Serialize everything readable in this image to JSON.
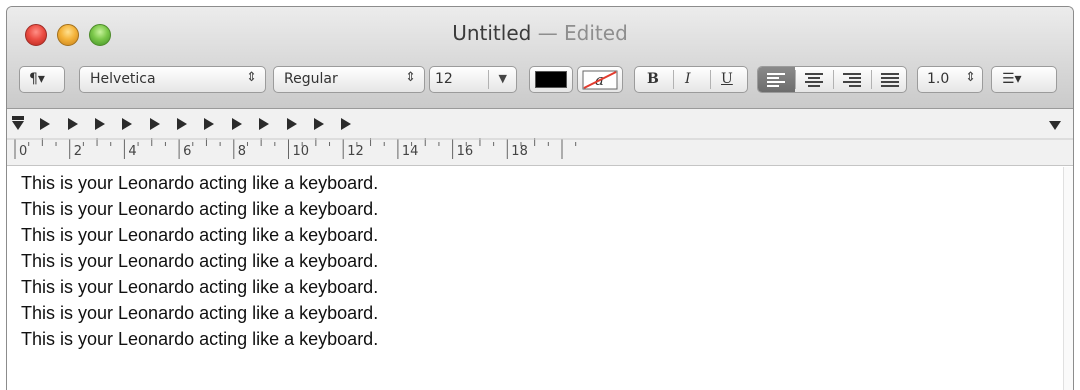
{
  "window": {
    "title": "Untitled",
    "separator": "—",
    "status": "Edited"
  },
  "toolbar": {
    "paragraph_styles": "¶▾",
    "font_family": "Helvetica",
    "font_style": "Regular",
    "font_size": "12",
    "text_color": "#000000",
    "bold": "B",
    "italic": "I",
    "underline": "U",
    "alignment": [
      "align-left",
      "align-center",
      "align-right",
      "align-justify"
    ],
    "selected_alignment": "align-left",
    "line_spacing": "1.0",
    "list_bullets": "☰▾"
  },
  "ruler": {
    "numbers": [
      "0",
      "2",
      "4",
      "6",
      "8",
      "10",
      "12",
      "14",
      "16",
      "18"
    ]
  },
  "document": {
    "lines": [
      "This is your Leonardo acting like a keyboard.",
      "This is your Leonardo acting like a keyboard.",
      "This is your Leonardo acting like a keyboard.",
      "This is your Leonardo acting like a keyboard.",
      "This is your Leonardo acting like a keyboard.",
      "This is your Leonardo acting like a keyboard.",
      "This is your Leonardo acting like a keyboard."
    ]
  }
}
